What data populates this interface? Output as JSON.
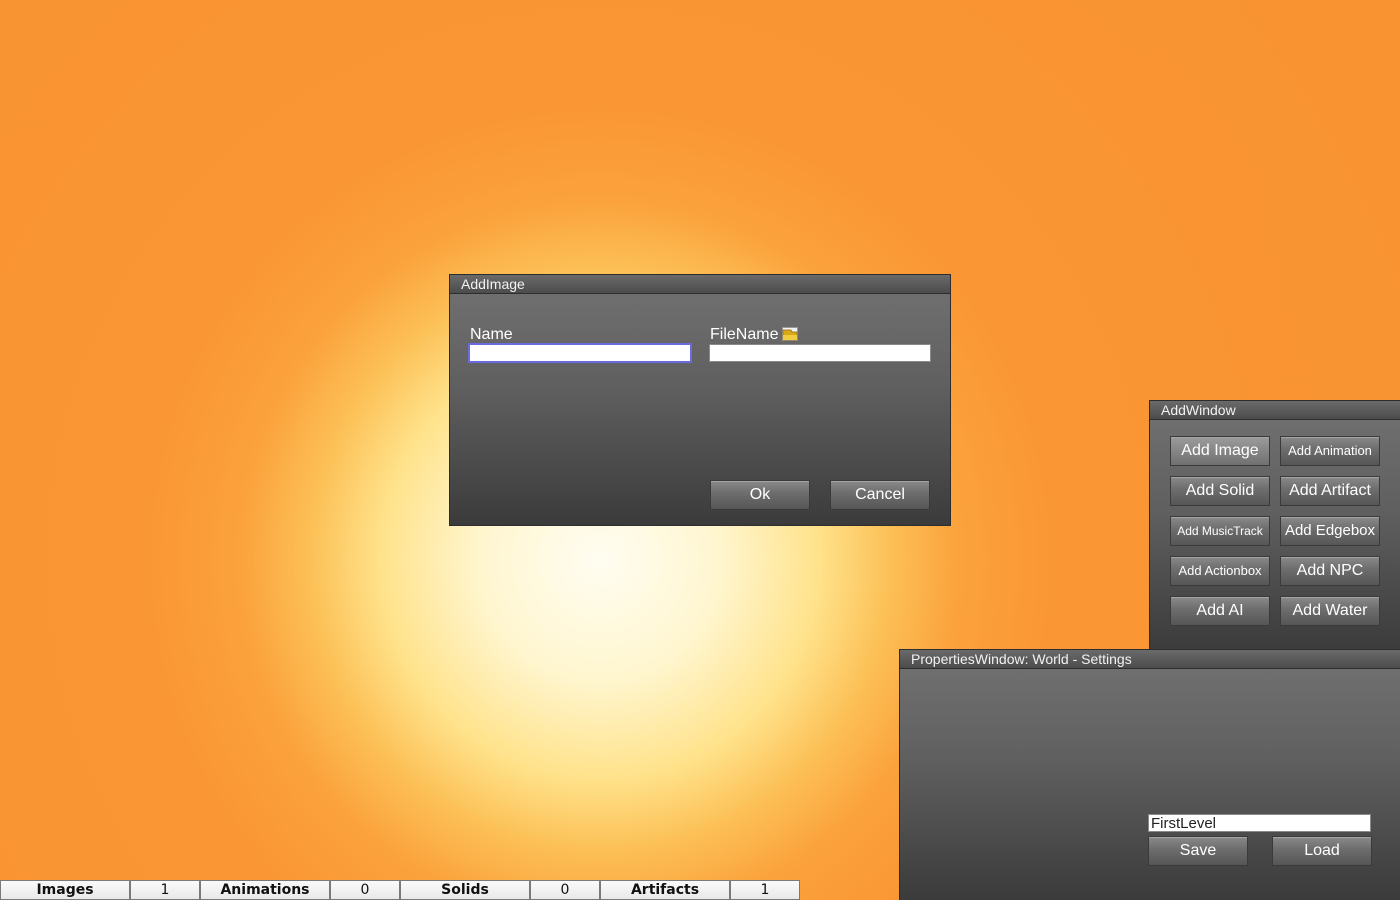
{
  "add_image_dialog": {
    "title": "AddImage",
    "name_label": "Name",
    "name_value": "",
    "filename_label": "FileName",
    "filename_icon": "folder-icon",
    "filename_value": "",
    "ok_label": "Ok",
    "cancel_label": "Cancel"
  },
  "add_window": {
    "title": "AddWindow",
    "buttons": [
      "Add Image",
      "Add Animation",
      "Add Solid",
      "Add Artifact",
      "Add MusicTrack",
      "Add Edgebox",
      "Add Actionbox",
      "Add NPC",
      "Add AI",
      "Add Water"
    ]
  },
  "properties_window": {
    "title": "PropertiesWindow: World - Settings",
    "level_value": "FirstLevel",
    "save_label": "Save",
    "load_label": "Load"
  },
  "status_bar": [
    {
      "label": "Images",
      "count": "1"
    },
    {
      "label": "Animations",
      "count": "0"
    },
    {
      "label": "Solids",
      "count": "0"
    },
    {
      "label": "Artifacts",
      "count": "1"
    }
  ],
  "colors": {
    "background_center": "#fffdf2",
    "background_outer": "#f99331",
    "window_top": "#727272",
    "window_bottom": "#3b3b3b",
    "focus_border": "#6b6be0"
  }
}
